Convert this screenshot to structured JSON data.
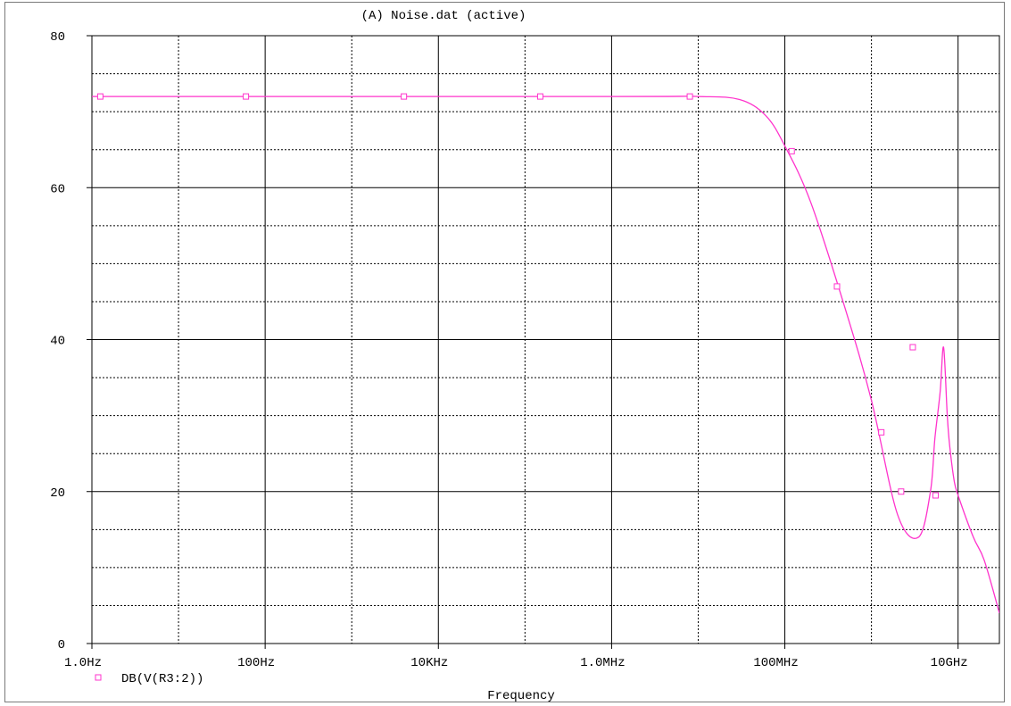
{
  "chart_data": {
    "type": "line",
    "title": "(A) Noise.dat (active)",
    "xlabel": "Frequency",
    "ylabel": "",
    "x_scale": "log",
    "xlim": [
      1,
      30000000000
    ],
    "ylim": [
      0,
      80
    ],
    "x_ticks": [
      {
        "value": 1,
        "label": "1.0Hz"
      },
      {
        "value": 100,
        "label": "100Hz"
      },
      {
        "value": 10000,
        "label": "10KHz"
      },
      {
        "value": 1000000,
        "label": "1.0MHz"
      },
      {
        "value": 100000000,
        "label": "100MHz"
      },
      {
        "value": 10000000000,
        "label": "10GHz"
      }
    ],
    "y_ticks": [
      {
        "value": 0,
        "label": "0"
      },
      {
        "value": 20,
        "label": "20"
      },
      {
        "value": 40,
        "label": "40"
      },
      {
        "value": 60,
        "label": "60"
      },
      {
        "value": 80,
        "label": "80"
      }
    ],
    "grid": true,
    "legend": "bottom-left",
    "series": [
      {
        "name": "DB(V(R3:2))",
        "color": "#ff33cc",
        "marker": "square",
        "x": [
          1,
          1000000,
          10000000,
          30000000,
          60000000,
          100000000,
          200000000,
          500000000,
          1000000000,
          2000000000,
          3500000000,
          4800000000,
          5400000000,
          6200000000,
          6800000000,
          7500000000,
          8000000000,
          9000000000,
          10000000000,
          15000000000,
          20000000000,
          30000000000
        ],
        "values": [
          72,
          72,
          72,
          71.6,
          69.5,
          65.5,
          58,
          44,
          32,
          17,
          14,
          20,
          27,
          33,
          39,
          30,
          26,
          21.5,
          19.5,
          14,
          11,
          4
        ],
        "markers_x": [
          1.25,
          60,
          4000,
          150000,
          8000000,
          120000000,
          400000000,
          1300000000,
          2200000000,
          3000000000,
          5500000000
        ],
        "markers_y": [
          72,
          72,
          72,
          72,
          72,
          64.8,
          47,
          27.8,
          20,
          39,
          19.5
        ]
      }
    ]
  }
}
